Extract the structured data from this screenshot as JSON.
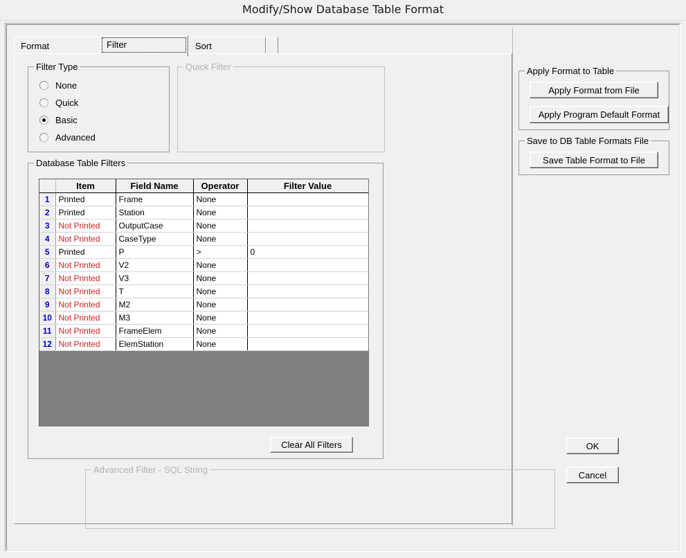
{
  "window": {
    "title": "Modify/Show Database Table Format"
  },
  "tabs": [
    {
      "label": "Format",
      "active": false
    },
    {
      "label": "Filter",
      "active": true
    },
    {
      "label": "Sort",
      "active": false
    }
  ],
  "filter_type": {
    "legend": "Filter Type",
    "options": [
      {
        "label": "None",
        "checked": false
      },
      {
        "label": "Quick",
        "checked": false
      },
      {
        "label": "Basic",
        "checked": true
      },
      {
        "label": "Advanced",
        "checked": false
      }
    ]
  },
  "quick_filter": {
    "legend": "Quick Filter",
    "enabled": false
  },
  "database_table_filters": {
    "legend": "Database Table Filters",
    "columns": [
      "",
      "Item",
      "Field Name",
      "Operator",
      "Filter Value"
    ],
    "rows": [
      {
        "num": "1",
        "item": "Printed",
        "printed": true,
        "field": "Frame",
        "operator": "None",
        "value": ""
      },
      {
        "num": "2",
        "item": "Printed",
        "printed": true,
        "field": "Station",
        "operator": "None",
        "value": ""
      },
      {
        "num": "3",
        "item": "Not Printed",
        "printed": false,
        "field": "OutputCase",
        "operator": "None",
        "value": ""
      },
      {
        "num": "4",
        "item": "Not Printed",
        "printed": false,
        "field": "CaseType",
        "operator": "None",
        "value": ""
      },
      {
        "num": "5",
        "item": "Printed",
        "printed": true,
        "field": "P",
        "operator": ">",
        "value": "0"
      },
      {
        "num": "6",
        "item": "Not Printed",
        "printed": false,
        "field": "V2",
        "operator": "None",
        "value": ""
      },
      {
        "num": "7",
        "item": "Not Printed",
        "printed": false,
        "field": "V3",
        "operator": "None",
        "value": ""
      },
      {
        "num": "8",
        "item": "Not Printed",
        "printed": false,
        "field": "T",
        "operator": "None",
        "value": ""
      },
      {
        "num": "9",
        "item": "Not Printed",
        "printed": false,
        "field": "M2",
        "operator": "None",
        "value": ""
      },
      {
        "num": "10",
        "item": "Not Printed",
        "printed": false,
        "field": "M3",
        "operator": "None",
        "value": ""
      },
      {
        "num": "11",
        "item": "Not Printed",
        "printed": false,
        "field": "FrameElem",
        "operator": "None",
        "value": ""
      },
      {
        "num": "12",
        "item": "Not Printed",
        "printed": false,
        "field": "ElemStation",
        "operator": "None",
        "value": ""
      }
    ],
    "clear_button": "Clear All Filters"
  },
  "advanced_filter": {
    "legend": "Advanced Filter - SQL String",
    "enabled": false,
    "value": ""
  },
  "apply_format_group": {
    "legend": "Apply Format to Table",
    "buttons": [
      "Apply Format from File",
      "Apply Program Default Format"
    ]
  },
  "save_group": {
    "legend": "Save to DB Table Formats File",
    "buttons": [
      "Save Table Format to File"
    ]
  },
  "dialog_buttons": {
    "ok": "OK",
    "cancel": "Cancel"
  },
  "colors": {
    "face": "#f0f0f0",
    "row_number": "#0000c8",
    "not_printed": "#d02020",
    "grid_filler": "#808080",
    "disabled_text": "#b3b3b3"
  }
}
